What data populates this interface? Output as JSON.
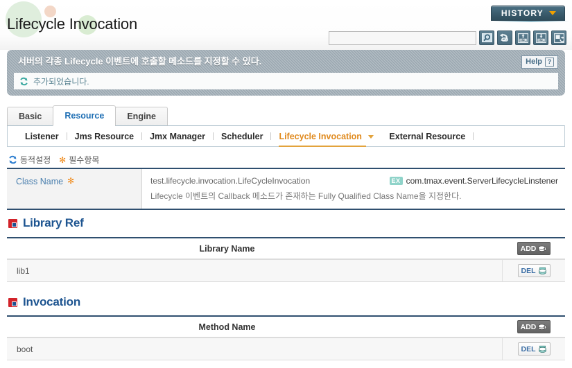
{
  "header": {
    "title": "Lifecycle Invocation",
    "history_label": "HISTORY",
    "search_placeholder": "",
    "search_value": "",
    "icons": [
      {
        "name": "search-icon",
        "tooltip": "Search"
      },
      {
        "name": "refresh-icon",
        "tooltip": "Refresh"
      },
      {
        "name": "xml-import-icon",
        "tooltip": "XML Import",
        "badge": "XML"
      },
      {
        "name": "xml-export-icon",
        "tooltip": "XML Export",
        "badge": "XML"
      },
      {
        "name": "save-config-icon",
        "tooltip": "Save"
      }
    ]
  },
  "notice": {
    "title": "서버의 각종 Lifecycle 이벤트에 호출할 메소드를 지정할 수 있다.",
    "help_label": "Help",
    "help_mark": "?",
    "message": "추가되었습니다."
  },
  "tabs": [
    {
      "label": "Basic",
      "active": false
    },
    {
      "label": "Resource",
      "active": true
    },
    {
      "label": "Engine",
      "active": false
    }
  ],
  "subtabs": [
    {
      "label": "Listener",
      "active": false,
      "caret": false
    },
    {
      "label": "Jms Resource",
      "active": false,
      "caret": false
    },
    {
      "label": "Jmx Manager",
      "active": false,
      "caret": false
    },
    {
      "label": "Scheduler",
      "active": false,
      "caret": false
    },
    {
      "label": "Lifecycle Invocation",
      "active": true,
      "caret": true
    },
    {
      "label": "External Resource",
      "active": false,
      "caret": false
    }
  ],
  "legend": {
    "dynamic_label": "동적설정",
    "required_label": "필수항목",
    "required_mark": "✻"
  },
  "property": {
    "label": "Class Name",
    "required_mark": "✻",
    "value": "test.lifecycle.invocation.LifeCycleInvocation",
    "example_badge": "EX",
    "example_value": "com.tmax.event.ServerLifecycleLinstener",
    "description": "Lifecycle 이벤트의 Callback 메소드가 존재하는 Fully Qualified Class Name을 지정한다."
  },
  "sections": [
    {
      "title": "Library Ref",
      "column_header": "Library Name",
      "add_label": "ADD",
      "rows": [
        {
          "name": "lib1",
          "del_label": "DEL"
        }
      ]
    },
    {
      "title": "Invocation",
      "column_header": "Method Name",
      "add_label": "ADD",
      "rows": [
        {
          "name": "boot",
          "del_label": "DEL"
        }
      ]
    }
  ]
}
